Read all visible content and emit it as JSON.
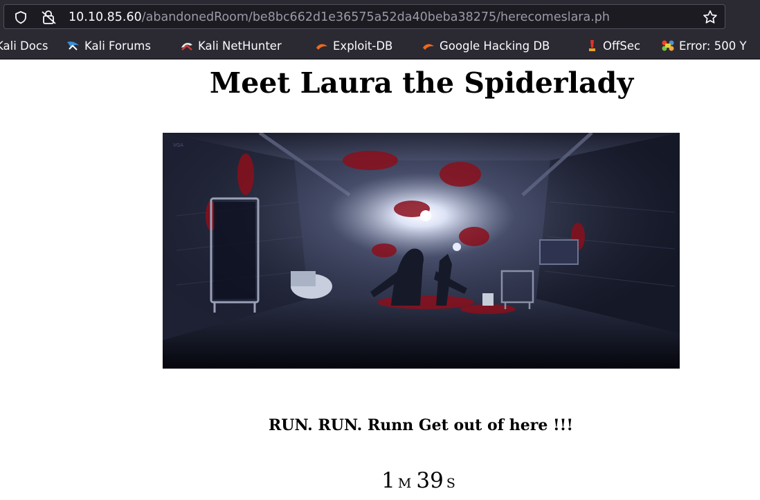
{
  "browser": {
    "url_host": "10.10.85.60",
    "url_path": "/abandonedRoom/be8bc662d1e36575a52da40beba38275/herecomeslara.ph",
    "bookmarks": [
      {
        "label": "Kali Docs",
        "icon": "kali-docs-icon"
      },
      {
        "label": "Kali Forums",
        "icon": "kali-forums-icon"
      },
      {
        "label": "Kali NetHunter",
        "icon": "kali-nethunter-icon"
      },
      {
        "label": "Exploit-DB",
        "icon": "exploit-db-icon"
      },
      {
        "label": "Google Hacking DB",
        "icon": "google-hacking-db-icon"
      },
      {
        "label": "OffSec",
        "icon": "offsec-icon"
      },
      {
        "label": "Error: 500 Y",
        "icon": "joomla-icon"
      }
    ]
  },
  "page": {
    "title": "Meet Laura the Spiderlady",
    "warning": "RUN. RUN. Runn Get out of here !!!",
    "countdown": {
      "minutes": "1",
      "minutes_unit": "M",
      "seconds": "39",
      "seconds_unit": "S"
    }
  },
  "colors": {
    "chrome_bg": "#2b2a33",
    "urlbar_bg": "#1c1b22",
    "url_host": "#fbfbfe",
    "url_path": "#9a9aa6",
    "blood": "#8a0f1c"
  }
}
